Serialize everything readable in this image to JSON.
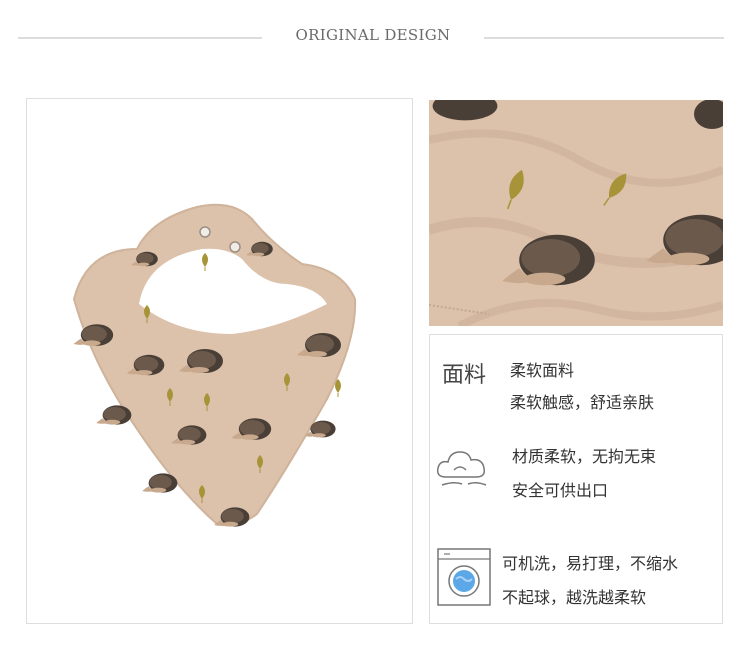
{
  "header": {
    "title": "ORIGINAL DESIGN"
  },
  "colors": {
    "fabric": "#dcc1ab",
    "hedgehog": "#4a3f37",
    "leaf": "#a89438",
    "washer_blue": "#5ca7e8"
  },
  "features": {
    "fabric": {
      "heading": "面料",
      "line1": "柔软面料",
      "line2": "柔软触感，舒适亲肤",
      "icon": "none"
    },
    "material": {
      "line1": "材质柔软，无拘无束",
      "line2": "安全可供出口",
      "icon": "cloud-icon"
    },
    "washing": {
      "line1": "可机洗，易打理，不缩水",
      "line2": "不起球，越洗越柔软",
      "icon": "washing-machine-icon"
    }
  }
}
